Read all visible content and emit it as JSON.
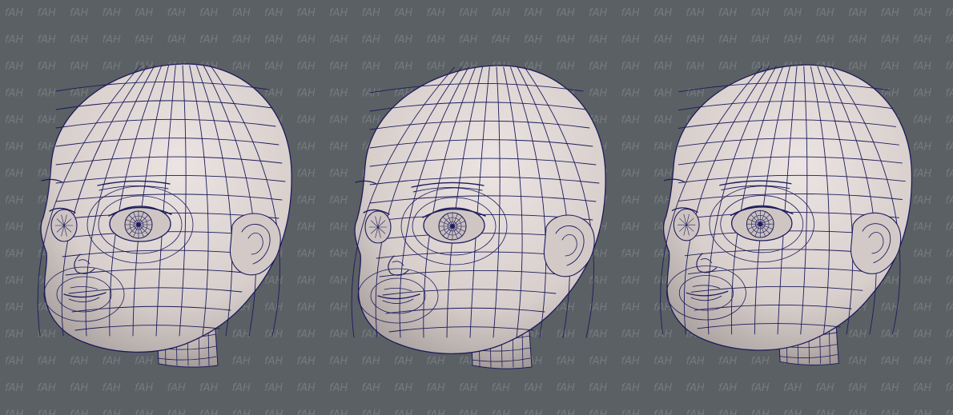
{
  "watermark": {
    "text": "fAH"
  },
  "colors": {
    "background": "#5b6064",
    "skin": "#dcd3d1",
    "wire": "#1c1b5c",
    "watermark": "#7a7f83"
  },
  "heads": [
    {
      "name": "head-left"
    },
    {
      "name": "head-middle"
    },
    {
      "name": "head-right"
    }
  ]
}
